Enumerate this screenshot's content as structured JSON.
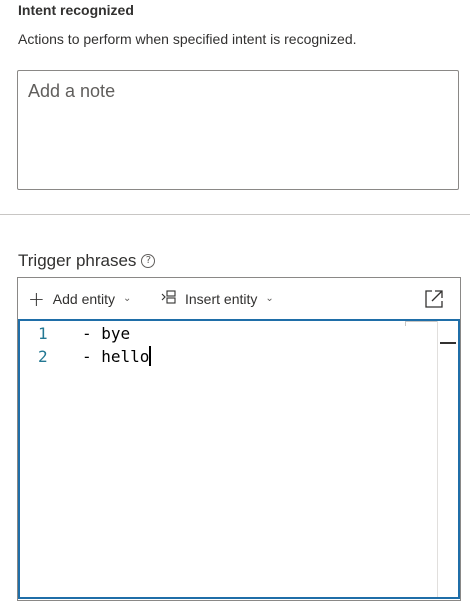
{
  "intent": {
    "title": "Intent recognized",
    "description": "Actions to perform when specified intent is recognized.",
    "note_placeholder": "Add a note"
  },
  "trigger": {
    "label": "Trigger phrases",
    "help_icon": "help-circle-icon",
    "toolbar": {
      "add_entity_label": "Add entity",
      "insert_entity_label": "Insert entity",
      "add_icon": "plus-icon",
      "insert_icon": "insert-entity-icon",
      "expand_icon": "open-in-new-window-icon"
    },
    "editor": {
      "lines": [
        {
          "number": "1",
          "text": "- bye"
        },
        {
          "number": "2",
          "text": "- hello"
        }
      ]
    }
  },
  "colors": {
    "editor_focus_border": "#1f6ea8",
    "line_number": "#237893",
    "text": "#323130"
  }
}
